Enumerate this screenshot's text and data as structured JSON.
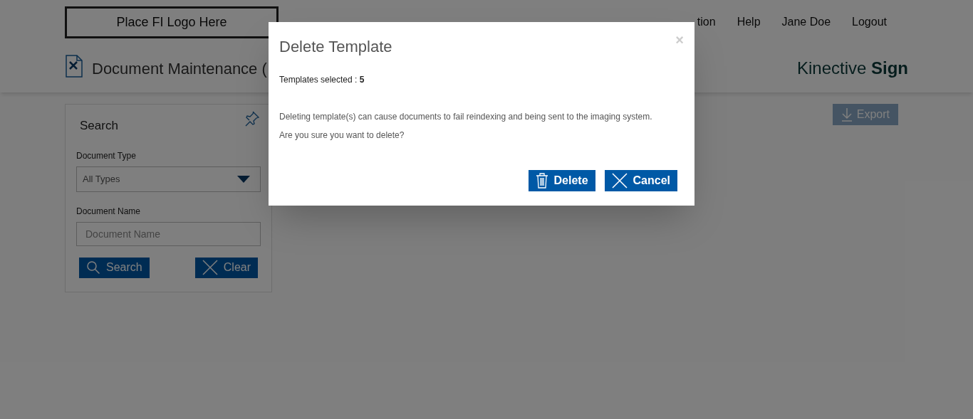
{
  "header": {
    "logo": "Place FI Logo Here",
    "nav": [
      "tion",
      "Help",
      "Jane Doe",
      "Logout"
    ]
  },
  "subheader": {
    "title": "Document Maintenance (",
    "brand_light": "Kinective",
    "brand_bold": "Sign"
  },
  "search_panel": {
    "title": "Search",
    "fields": [
      {
        "kind": "select",
        "label": "Document Type",
        "value": "All Types"
      },
      {
        "kind": "text",
        "label": "Document Name",
        "placeholder": "Document Name"
      }
    ],
    "buttons": [
      {
        "kind": "search",
        "label": "Search"
      },
      {
        "kind": "clear",
        "label": "Clear"
      }
    ]
  },
  "export_button": {
    "label": "Export"
  },
  "dialog": {
    "title": "Delete Template",
    "close": "×",
    "selected_text": "Templates selected : **5**",
    "message": [
      "Deleting template(s) can cause documents to fail reindexing and being sent to the imaging system.",
      "Are you sure you want to delete?"
    ],
    "buttons": [
      {
        "kind": "delete",
        "label": "Delete"
      },
      {
        "kind": "cancel",
        "label": "Cancel"
      }
    ]
  }
}
